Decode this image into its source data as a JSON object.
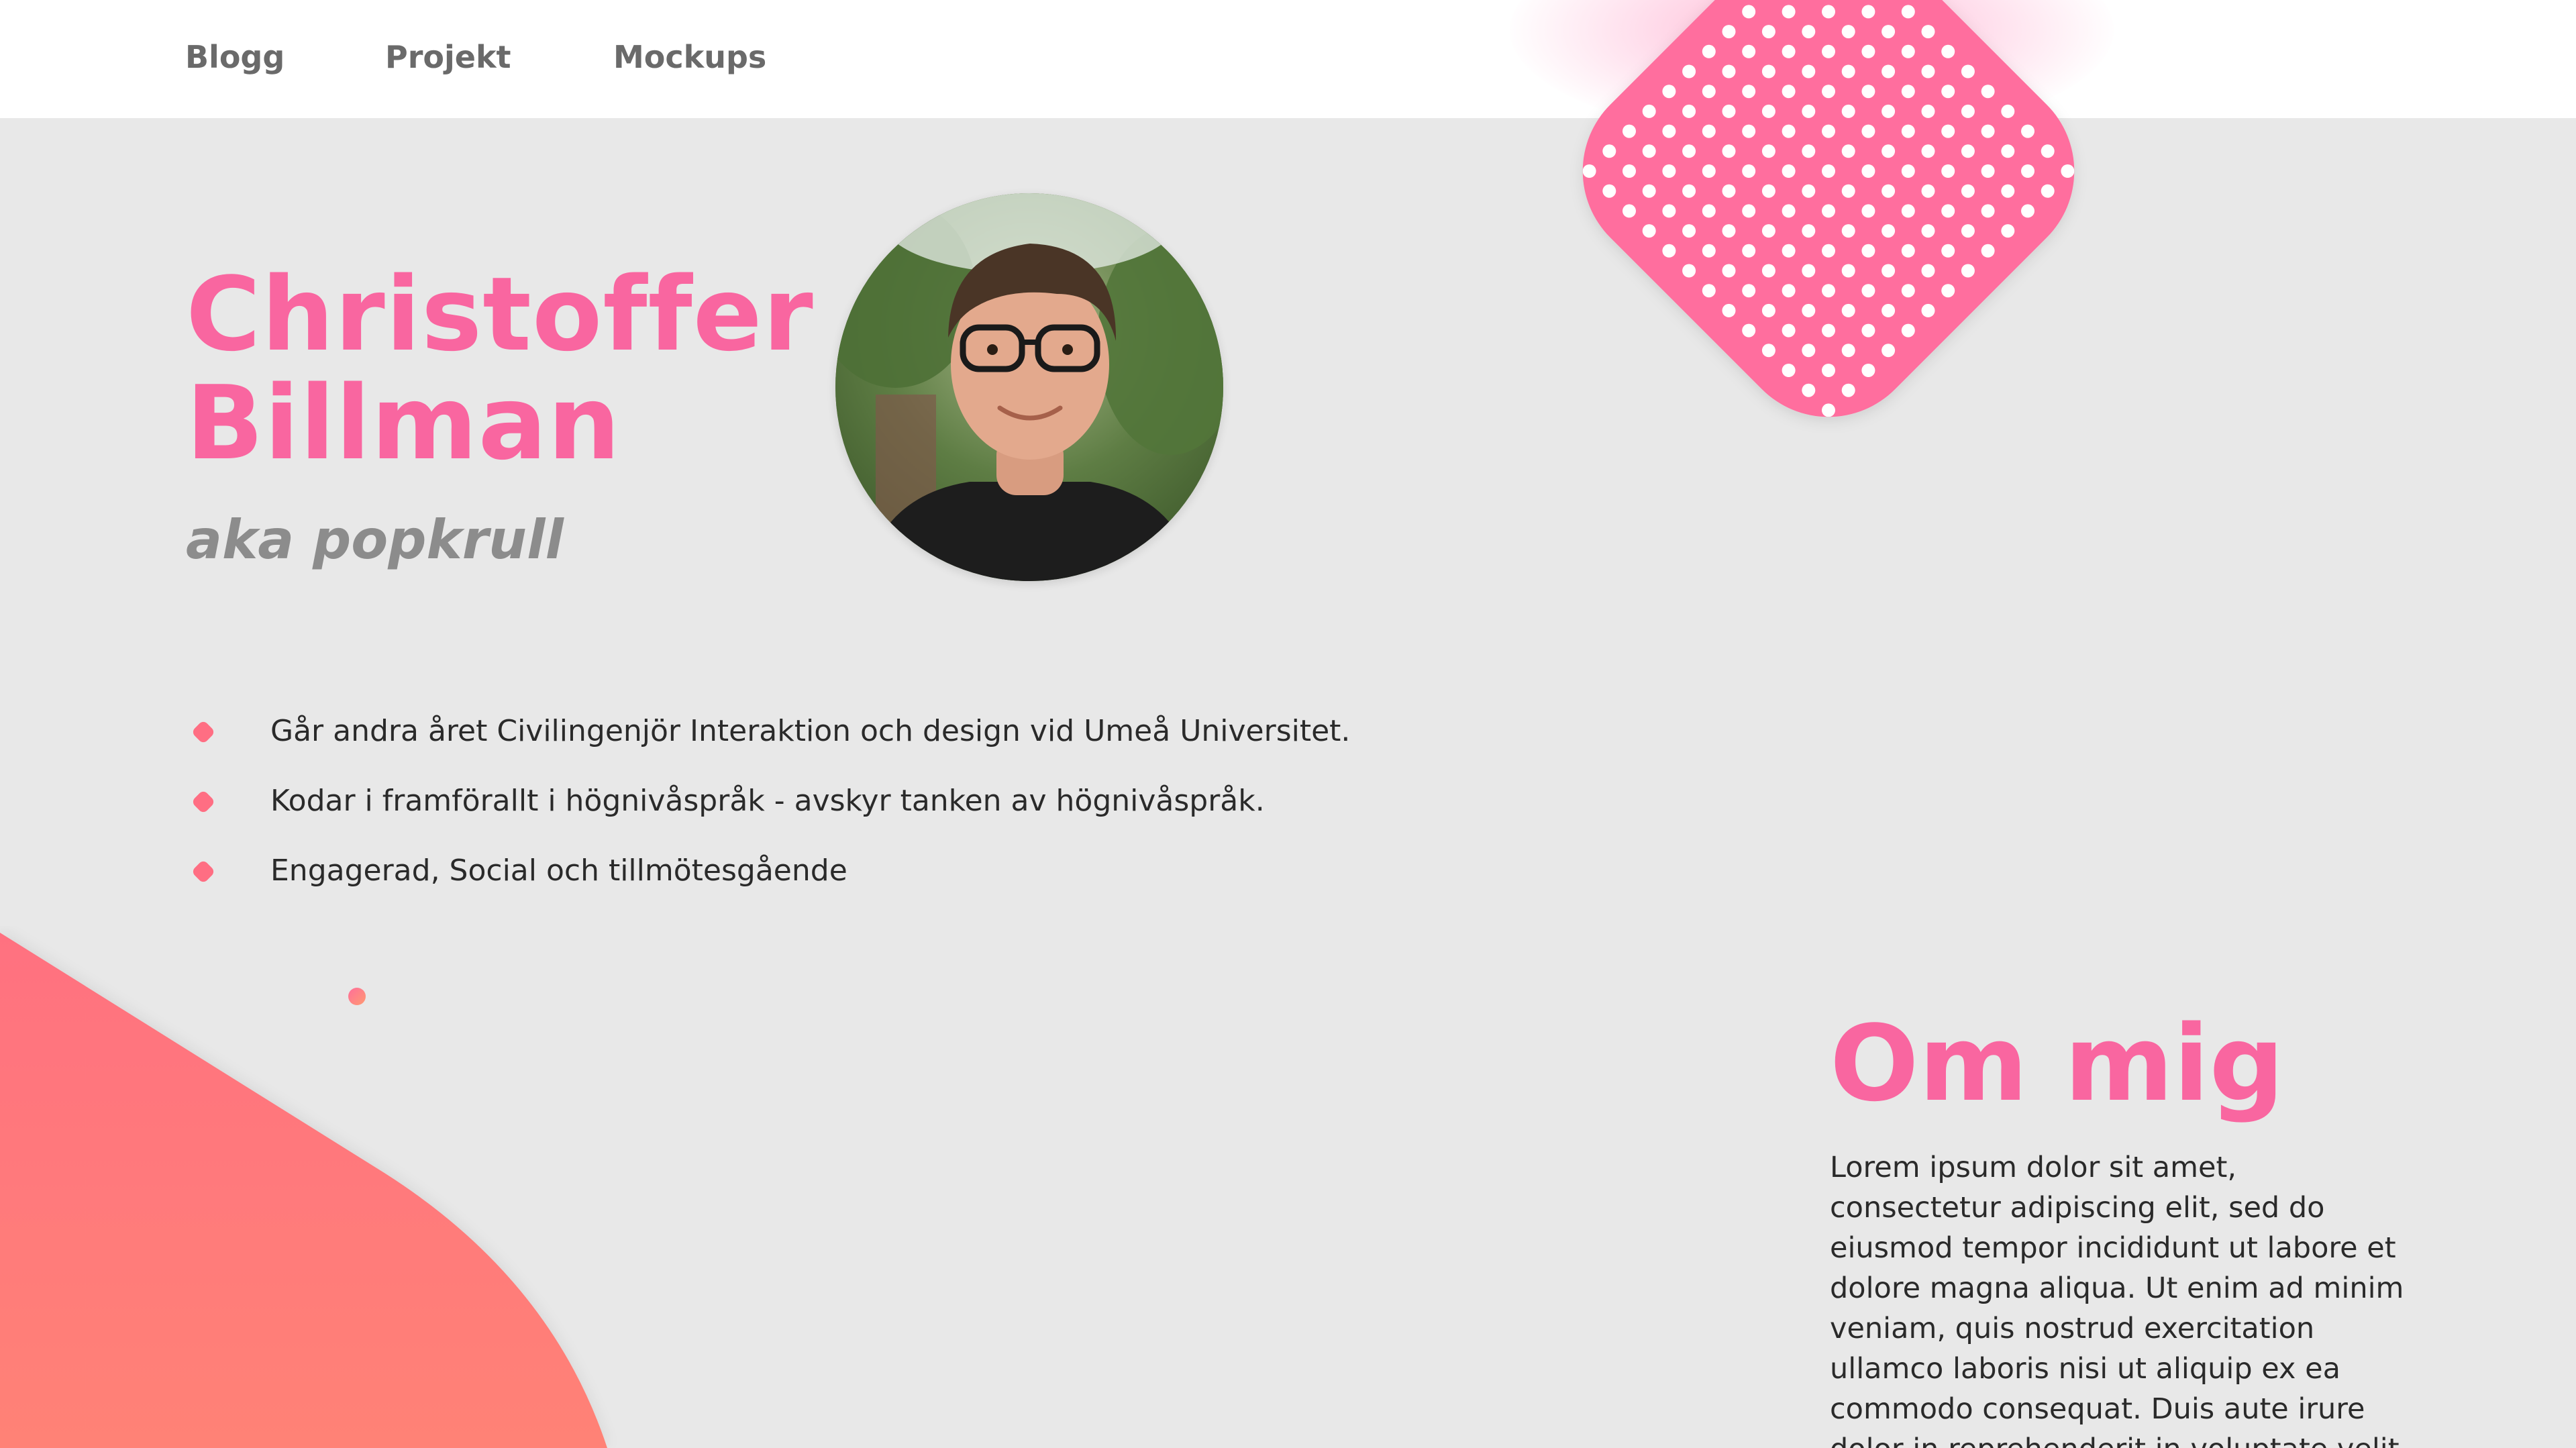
{
  "nav": {
    "items": [
      {
        "label": "Blogg"
      },
      {
        "label": "Projekt"
      },
      {
        "label": "Mockups"
      }
    ]
  },
  "hero": {
    "first_name": "Christoffer",
    "last_name": "Billman",
    "alias": "aka popkrull"
  },
  "facts": [
    "Går andra året Civilingenjör Interaktion och design vid Umeå Universitet.",
    "Kodar i framförallt i högnivåspråk - avskyr tanken av högnivåspråk.",
    "Engagerad, Social och tillmötesgående"
  ],
  "about": {
    "title": "Om mig",
    "text": "Lorem ipsum dolor sit amet, consectetur adipiscing elit, sed do eiusmod tempor incididunt ut labore et dolore magna aliqua. Ut enim ad minim veniam, quis nostrud exercitation ullamco laboris nisi ut aliquip ex ea commodo consequat. Duis aute irure dolor in reprehenderit in voluptate velit esse cillum dolore eu"
  },
  "icons": {
    "bullet": "rounded-diamond-icon",
    "decoration": "dotted-diamond-shape"
  },
  "colors": {
    "accent_pink": "#f966a0",
    "diamond_pink": "#ff6e9e",
    "coral": "#ff7f7a",
    "background": "#e8e8e8",
    "nav_text": "#6a6a6a",
    "alias_text": "#8c8c8c"
  }
}
